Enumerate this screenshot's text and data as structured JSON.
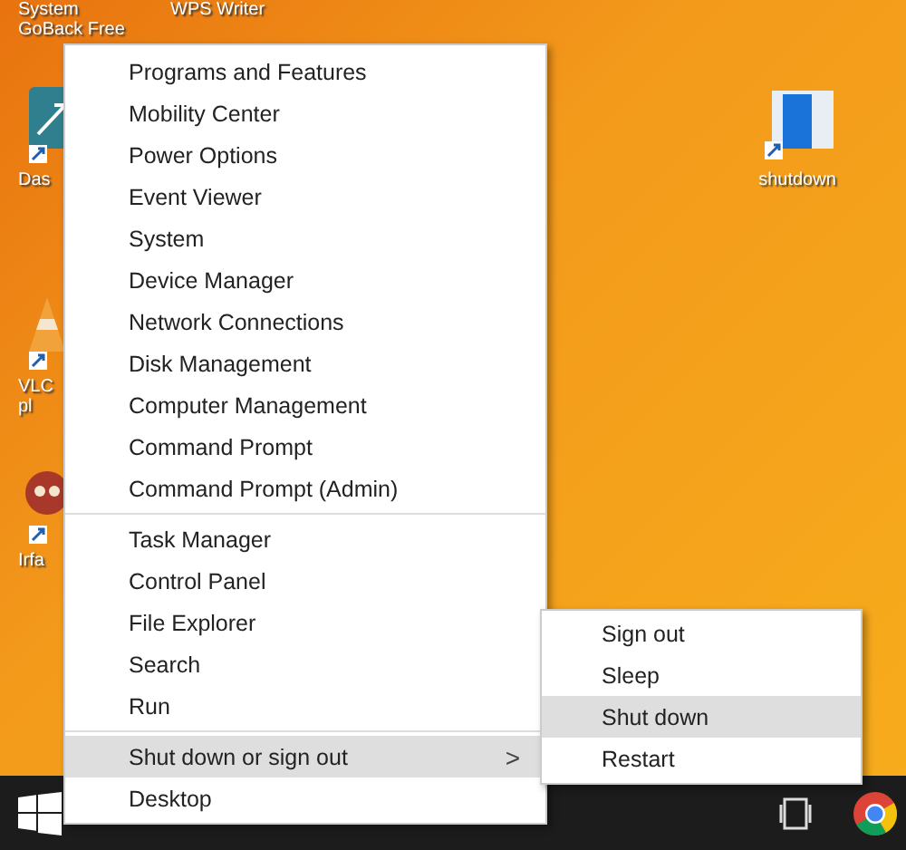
{
  "desktop_icons": [
    {
      "lines": [
        "System",
        "GoBack Free"
      ],
      "kind": "top"
    },
    {
      "lines": [
        "WPS Writer"
      ],
      "kind": "top"
    },
    {
      "lines": [
        "Das"
      ],
      "kind": "app"
    },
    {
      "lines": [
        "VLC",
        "pl"
      ],
      "kind": "cone"
    },
    {
      "lines": [
        "Irfa"
      ],
      "kind": "animal"
    },
    {
      "lines": [
        "shutdown"
      ],
      "kind": "window"
    }
  ],
  "menu": {
    "groups": [
      [
        {
          "label": "Programs and Features",
          "selected": false
        },
        {
          "label": "Mobility Center",
          "selected": false
        },
        {
          "label": "Power Options",
          "selected": false
        },
        {
          "label": "Event Viewer",
          "selected": false
        },
        {
          "label": "System",
          "selected": false
        },
        {
          "label": "Device Manager",
          "selected": false
        },
        {
          "label": "Network Connections",
          "selected": false
        },
        {
          "label": "Disk Management",
          "selected": false
        },
        {
          "label": "Computer Management",
          "selected": false
        },
        {
          "label": "Command Prompt",
          "selected": false
        },
        {
          "label": "Command Prompt (Admin)",
          "selected": false
        }
      ],
      [
        {
          "label": "Task Manager",
          "selected": false
        },
        {
          "label": "Control Panel",
          "selected": false
        },
        {
          "label": "File Explorer",
          "selected": false
        },
        {
          "label": "Search",
          "selected": false
        },
        {
          "label": "Run",
          "selected": false
        }
      ],
      [
        {
          "label": "Shut down or sign out",
          "selected": true,
          "arrow": ">"
        },
        {
          "label": "Desktop",
          "selected": false
        }
      ]
    ]
  },
  "submenu": [
    {
      "label": "Sign out",
      "selected": false
    },
    {
      "label": "Sleep",
      "selected": false
    },
    {
      "label": "Shut down",
      "selected": true
    },
    {
      "label": "Restart",
      "selected": false
    }
  ]
}
